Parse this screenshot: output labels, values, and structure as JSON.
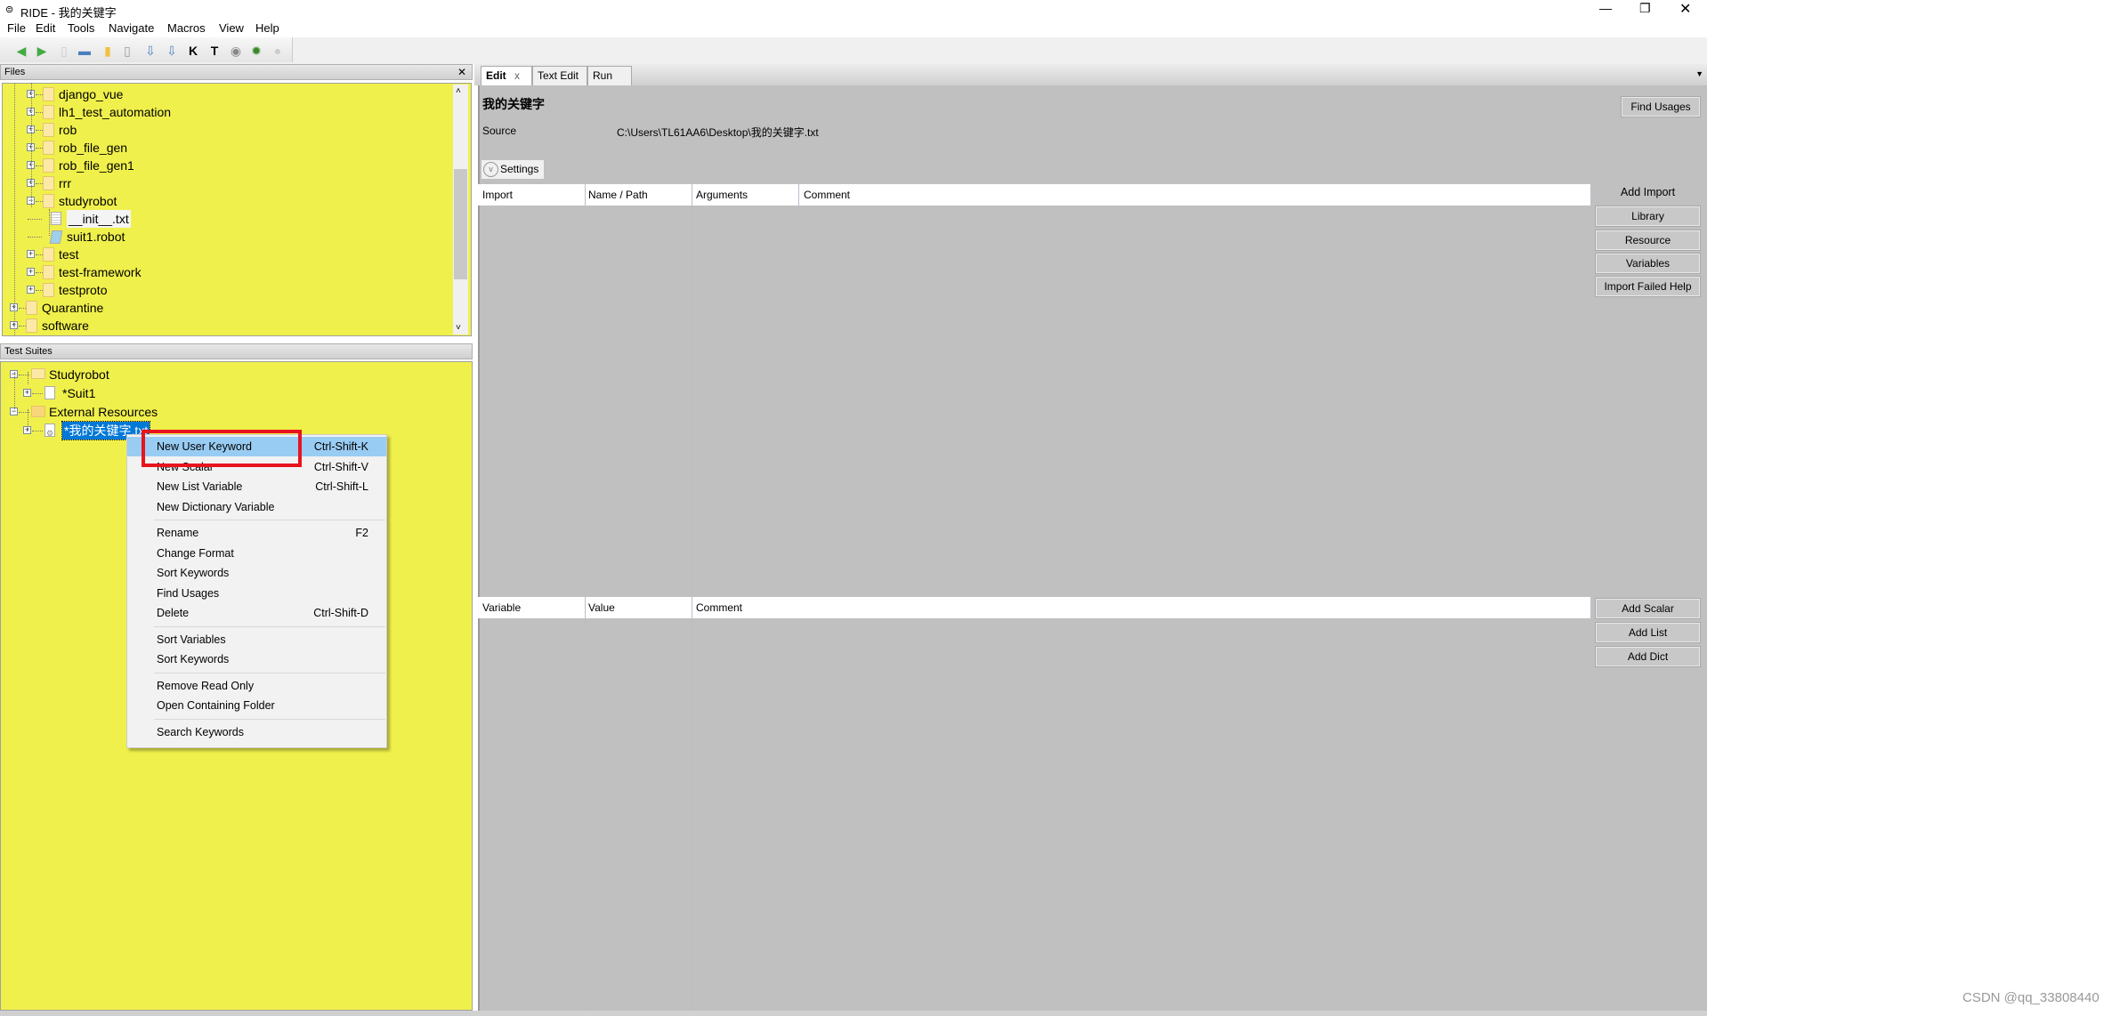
{
  "window": {
    "title": "RIDE - 我的关键字",
    "controls": [
      "minimize",
      "restore",
      "close"
    ]
  },
  "menu": [
    "File",
    "Edit",
    "Tools",
    "Navigate",
    "Macros",
    "View",
    "Help"
  ],
  "toolbar": [
    "back-icon",
    "forward-icon",
    "new-project-icon",
    "open-icon",
    "open-directory-icon",
    "new-file-icon",
    "save-icon",
    "save-all-icon",
    "search-keywords-icon",
    "search-tests-icon",
    "run-icon",
    "debug-bug-icon",
    "stop-icon"
  ],
  "files": {
    "header": "Files",
    "close": "✕",
    "items": [
      {
        "label": "django_vue",
        "level": 1,
        "type": "folder",
        "exp": "+"
      },
      {
        "label": "lh1_test_automation",
        "level": 1,
        "type": "folder",
        "exp": "+"
      },
      {
        "label": "rob",
        "level": 1,
        "type": "folder",
        "exp": "+"
      },
      {
        "label": "rob_file_gen",
        "level": 1,
        "type": "folder",
        "exp": "+"
      },
      {
        "label": "rob_file_gen1",
        "level": 1,
        "type": "folder",
        "exp": "+"
      },
      {
        "label": "rrr",
        "level": 1,
        "type": "folder",
        "exp": "+"
      },
      {
        "label": "studyrobot",
        "level": 1,
        "type": "folder",
        "exp": "−"
      },
      {
        "label": "__init__.txt",
        "level": 2,
        "type": "txt",
        "exp": ""
      },
      {
        "label": "suit1.robot",
        "level": 2,
        "type": "robot",
        "exp": ""
      },
      {
        "label": "test",
        "level": 1,
        "type": "folder",
        "exp": "+"
      },
      {
        "label": "test-framework",
        "level": 1,
        "type": "folder",
        "exp": "+"
      },
      {
        "label": "testproto",
        "level": 1,
        "type": "folder",
        "exp": "+"
      },
      {
        "label": "Quarantine",
        "level": 0,
        "type": "folder",
        "exp": "+"
      },
      {
        "label": "software",
        "level": 0,
        "type": "folder",
        "exp": "+"
      }
    ]
  },
  "suites": {
    "header": "Test Suites",
    "items": [
      {
        "label": "Studyrobot",
        "level": 0,
        "exp": "−",
        "type": "folder"
      },
      {
        "label": "*Suit1",
        "level": 1,
        "exp": "+",
        "type": "doc"
      },
      {
        "label": "External Resources",
        "level": 0,
        "exp": "−",
        "type": "resources"
      },
      {
        "label": "*我的关键字.txt",
        "level": 1,
        "exp": "+",
        "type": "resource",
        "selected": true
      }
    ]
  },
  "context_menu": {
    "groups": [
      [
        {
          "label": "New User Keyword",
          "shortcut": "Ctrl-Shift-K",
          "highlighted": true
        },
        {
          "label": "New Scalar",
          "shortcut": "Ctrl-Shift-V"
        },
        {
          "label": "New List Variable",
          "shortcut": "Ctrl-Shift-L"
        },
        {
          "label": "New Dictionary Variable",
          "shortcut": ""
        }
      ],
      [
        {
          "label": "Rename",
          "shortcut": "F2"
        },
        {
          "label": "Change Format",
          "shortcut": ""
        },
        {
          "label": "Sort Keywords",
          "shortcut": ""
        },
        {
          "label": "Find Usages",
          "shortcut": ""
        },
        {
          "label": "Delete",
          "shortcut": "Ctrl-Shift-D"
        }
      ],
      [
        {
          "label": "Sort Variables",
          "shortcut": ""
        },
        {
          "label": "Sort Keywords",
          "shortcut": ""
        }
      ],
      [
        {
          "label": "Remove Read Only",
          "shortcut": ""
        },
        {
          "label": "Open Containing Folder",
          "shortcut": ""
        }
      ],
      [
        {
          "label": "Search Keywords",
          "shortcut": ""
        }
      ]
    ],
    "annotation_color": "#e8141e"
  },
  "editor": {
    "tabs": [
      {
        "label": "Edit",
        "active": true,
        "close": "x"
      },
      {
        "label": "Text Edit"
      },
      {
        "label": "Run"
      }
    ],
    "title": "我的关键字",
    "find_usages": "Find Usages",
    "source_label": "Source",
    "source_path": "C:\\Users\\TL61AA6\\Desktop\\我的关键字.txt",
    "settings": "Settings",
    "import_columns": [
      "Import",
      "Name / Path",
      "Arguments",
      "Comment"
    ],
    "add_import": "Add Import",
    "import_buttons": [
      "Library",
      "Resource",
      "Variables",
      "Import Failed Help"
    ],
    "variable_columns": [
      "Variable",
      "Value",
      "Comment"
    ],
    "variable_buttons": [
      "Add Scalar",
      "Add List",
      "Add Dict"
    ]
  },
  "watermark": "CSDN @qq_33808440",
  "colors": {
    "tree_bg": "#f0f04c",
    "editor_bg": "#c0c0c0",
    "selection": "#0078d7",
    "menu_highlight": "#99ccf3"
  }
}
